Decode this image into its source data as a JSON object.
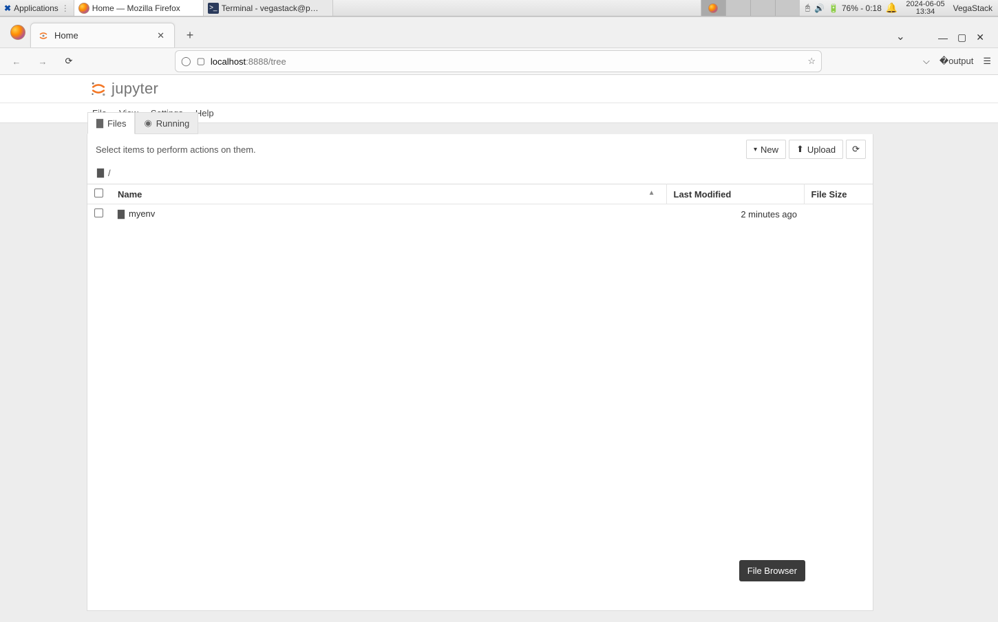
{
  "os": {
    "applications_label": "Applications",
    "task_firefox": "Home — Mozilla Firefox",
    "task_terminal": "Terminal - vegastack@p…",
    "battery": "76% - 0:18",
    "date": "2024-06-05",
    "time": "13:34",
    "user": "VegaStack"
  },
  "browser": {
    "tab_title": "Home",
    "url_host": "localhost",
    "url_rest": ":8888/tree"
  },
  "jupyter": {
    "logo_text": "jupyter",
    "menu": {
      "file": "File",
      "view": "View",
      "settings": "Settings",
      "help": "Help"
    },
    "tabs": {
      "files": "Files",
      "running": "Running"
    },
    "hint": "Select items to perform actions on them.",
    "buttons": {
      "new": "New",
      "upload": "Upload"
    },
    "breadcrumb_root": "/",
    "columns": {
      "name": "Name",
      "modified": "Last Modified",
      "size": "File Size"
    },
    "rows": [
      {
        "name": "myenv",
        "modified": "2 minutes ago",
        "size": ""
      }
    ],
    "tooltip": "File Browser"
  }
}
